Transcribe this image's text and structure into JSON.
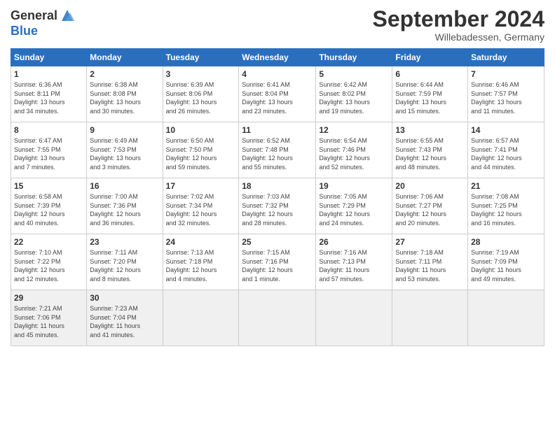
{
  "logo": {
    "line1": "General",
    "line2": "Blue"
  },
  "title": "September 2024",
  "subtitle": "Willebadessen, Germany",
  "days_header": [
    "Sunday",
    "Monday",
    "Tuesday",
    "Wednesday",
    "Thursday",
    "Friday",
    "Saturday"
  ],
  "weeks": [
    [
      {
        "num": "1",
        "info": "Sunrise: 6:36 AM\nSunset: 8:11 PM\nDaylight: 13 hours\nand 34 minutes."
      },
      {
        "num": "2",
        "info": "Sunrise: 6:38 AM\nSunset: 8:08 PM\nDaylight: 13 hours\nand 30 minutes."
      },
      {
        "num": "3",
        "info": "Sunrise: 6:39 AM\nSunset: 8:06 PM\nDaylight: 13 hours\nand 26 minutes."
      },
      {
        "num": "4",
        "info": "Sunrise: 6:41 AM\nSunset: 8:04 PM\nDaylight: 13 hours\nand 23 minutes."
      },
      {
        "num": "5",
        "info": "Sunrise: 6:42 AM\nSunset: 8:02 PM\nDaylight: 13 hours\nand 19 minutes."
      },
      {
        "num": "6",
        "info": "Sunrise: 6:44 AM\nSunset: 7:59 PM\nDaylight: 13 hours\nand 15 minutes."
      },
      {
        "num": "7",
        "info": "Sunrise: 6:46 AM\nSunset: 7:57 PM\nDaylight: 13 hours\nand 11 minutes."
      }
    ],
    [
      {
        "num": "8",
        "info": "Sunrise: 6:47 AM\nSunset: 7:55 PM\nDaylight: 13 hours\nand 7 minutes."
      },
      {
        "num": "9",
        "info": "Sunrise: 6:49 AM\nSunset: 7:53 PM\nDaylight: 13 hours\nand 3 minutes."
      },
      {
        "num": "10",
        "info": "Sunrise: 6:50 AM\nSunset: 7:50 PM\nDaylight: 12 hours\nand 59 minutes."
      },
      {
        "num": "11",
        "info": "Sunrise: 6:52 AM\nSunset: 7:48 PM\nDaylight: 12 hours\nand 55 minutes."
      },
      {
        "num": "12",
        "info": "Sunrise: 6:54 AM\nSunset: 7:46 PM\nDaylight: 12 hours\nand 52 minutes."
      },
      {
        "num": "13",
        "info": "Sunrise: 6:55 AM\nSunset: 7:43 PM\nDaylight: 12 hours\nand 48 minutes."
      },
      {
        "num": "14",
        "info": "Sunrise: 6:57 AM\nSunset: 7:41 PM\nDaylight: 12 hours\nand 44 minutes."
      }
    ],
    [
      {
        "num": "15",
        "info": "Sunrise: 6:58 AM\nSunset: 7:39 PM\nDaylight: 12 hours\nand 40 minutes."
      },
      {
        "num": "16",
        "info": "Sunrise: 7:00 AM\nSunset: 7:36 PM\nDaylight: 12 hours\nand 36 minutes."
      },
      {
        "num": "17",
        "info": "Sunrise: 7:02 AM\nSunset: 7:34 PM\nDaylight: 12 hours\nand 32 minutes."
      },
      {
        "num": "18",
        "info": "Sunrise: 7:03 AM\nSunset: 7:32 PM\nDaylight: 12 hours\nand 28 minutes."
      },
      {
        "num": "19",
        "info": "Sunrise: 7:05 AM\nSunset: 7:29 PM\nDaylight: 12 hours\nand 24 minutes."
      },
      {
        "num": "20",
        "info": "Sunrise: 7:06 AM\nSunset: 7:27 PM\nDaylight: 12 hours\nand 20 minutes."
      },
      {
        "num": "21",
        "info": "Sunrise: 7:08 AM\nSunset: 7:25 PM\nDaylight: 12 hours\nand 16 minutes."
      }
    ],
    [
      {
        "num": "22",
        "info": "Sunrise: 7:10 AM\nSunset: 7:22 PM\nDaylight: 12 hours\nand 12 minutes."
      },
      {
        "num": "23",
        "info": "Sunrise: 7:11 AM\nSunset: 7:20 PM\nDaylight: 12 hours\nand 8 minutes."
      },
      {
        "num": "24",
        "info": "Sunrise: 7:13 AM\nSunset: 7:18 PM\nDaylight: 12 hours\nand 4 minutes."
      },
      {
        "num": "25",
        "info": "Sunrise: 7:15 AM\nSunset: 7:16 PM\nDaylight: 12 hours\nand 1 minute."
      },
      {
        "num": "26",
        "info": "Sunrise: 7:16 AM\nSunset: 7:13 PM\nDaylight: 11 hours\nand 57 minutes."
      },
      {
        "num": "27",
        "info": "Sunrise: 7:18 AM\nSunset: 7:11 PM\nDaylight: 11 hours\nand 53 minutes."
      },
      {
        "num": "28",
        "info": "Sunrise: 7:19 AM\nSunset: 7:09 PM\nDaylight: 11 hours\nand 49 minutes."
      }
    ],
    [
      {
        "num": "29",
        "info": "Sunrise: 7:21 AM\nSunset: 7:06 PM\nDaylight: 11 hours\nand 45 minutes."
      },
      {
        "num": "30",
        "info": "Sunrise: 7:23 AM\nSunset: 7:04 PM\nDaylight: 11 hours\nand 41 minutes."
      },
      {
        "num": "",
        "info": ""
      },
      {
        "num": "",
        "info": ""
      },
      {
        "num": "",
        "info": ""
      },
      {
        "num": "",
        "info": ""
      },
      {
        "num": "",
        "info": ""
      }
    ]
  ]
}
